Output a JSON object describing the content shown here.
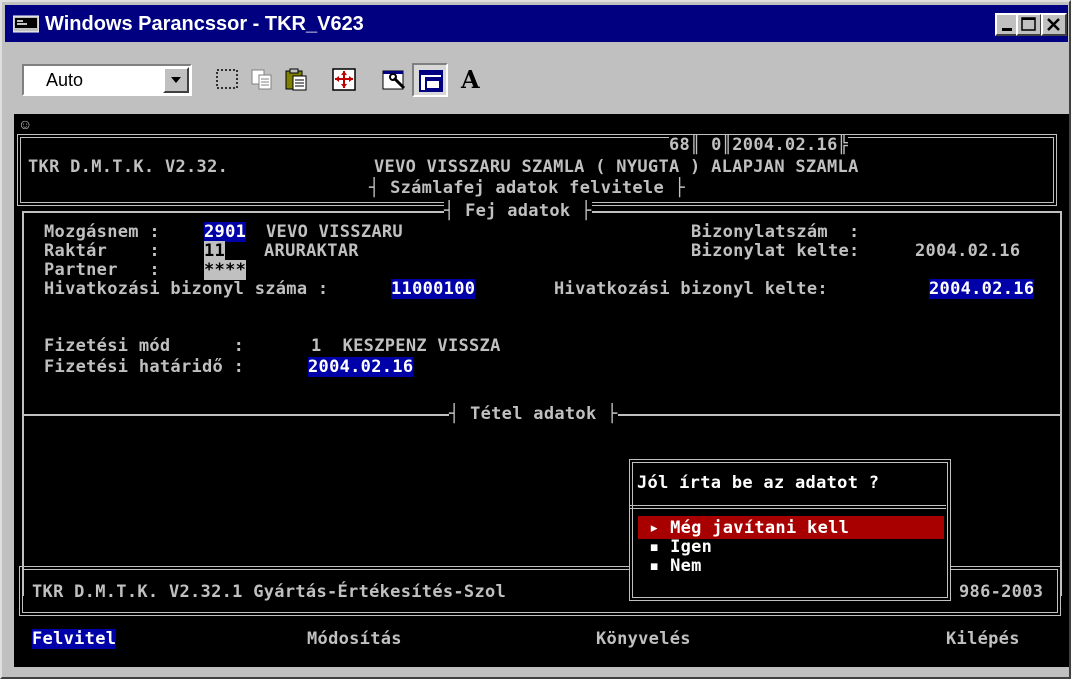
{
  "window": {
    "title": "Windows Parancssor - TKR_V623",
    "controls": [
      "minimize",
      "maximize",
      "close"
    ]
  },
  "toolbar": {
    "font_size_value": "Auto",
    "buttons": [
      "mark-icon",
      "copy-icon",
      "paste-icon",
      "fullscreen-icon",
      "properties-icon",
      "background-icon",
      "font-icon"
    ],
    "font_button_label": "A"
  },
  "header": {
    "counters": "68",
    "counter2": "0",
    "date": "2004.02.16",
    "app": "TKR D.M.T.K. V2.32.",
    "title": "VEVO VISSZARU SZAMLA ( NYUGTA ) ALAPJAN SZAMLA",
    "subtitle": "Számlafej adatok felvitele",
    "section_head": "Fej adatok",
    "section_items": "Tétel adatok"
  },
  "form": {
    "mozgasnem_label": "Mozgásnem :",
    "mozgasnem_code": "2901",
    "mozgasnem_name": "VEVO VISSZARU",
    "raktar_label": "Raktár    :",
    "raktar_code": "11",
    "raktar_name": "ARURAKTAR",
    "partner_label": "Partner   :",
    "partner_value": "****",
    "ref_num_label": "Hivatkozási bizonyl száma :",
    "ref_num_value": "11000100",
    "ref_date_label": "Hivatkozási bizonyl kelte:",
    "ref_date_value": "2004.02.16",
    "doc_num_label": "Bizonylatszám  :",
    "doc_date_label": "Bizonylat kelte:",
    "doc_date_value": "2004.02.16",
    "payment_label": "Fizetési mód      :",
    "payment_value": "1  KESZPENZ VISSZA",
    "due_label": "Fizetési határidő :",
    "due_value": "2004.02.16"
  },
  "dialog": {
    "question": "Jól írta be az adatot ?",
    "options": [
      "Még javítani kell",
      "Igen",
      "Nem"
    ],
    "selected_index": 0
  },
  "footer": {
    "left": "TKR D.M.T.K. V2.32.1 Gyártás-Értékesítés-Szol",
    "right": "986-2003"
  },
  "menu": [
    "Felvitel",
    "Módosítás",
    "Könyvelés",
    "Kilépés"
  ],
  "colors": {
    "titlebar": "#000080",
    "highlight": "#0000a8",
    "dialog_selection": "#a80000",
    "console_text": "#c0c0c0"
  }
}
